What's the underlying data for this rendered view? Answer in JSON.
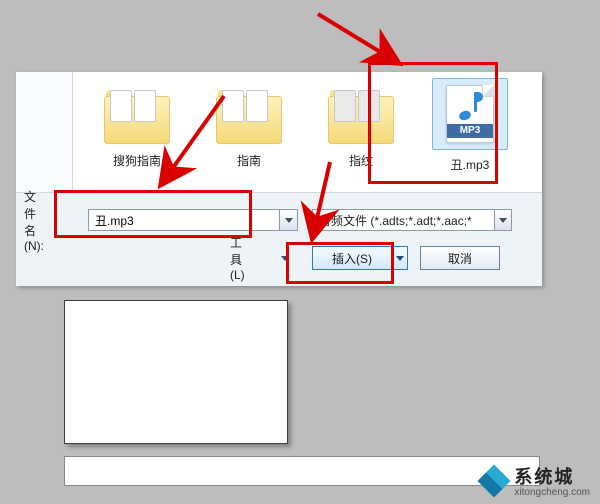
{
  "items": [
    {
      "label": "搜狗指南"
    },
    {
      "label": "指南"
    },
    {
      "label": "指纹"
    }
  ],
  "mp3": {
    "label": "丑.mp3",
    "badge": "MP3"
  },
  "form": {
    "filename_label": "文件名(N):",
    "filename_value": "丑.mp3",
    "filter_label": "音频文件 (*.adts;*.adt;*.aac;*",
    "tools_label": "工具(L)",
    "insert_label": "插入(S)",
    "cancel_label": "取消"
  },
  "watermark": {
    "title": "系统城",
    "url": "xitongcheng.com"
  }
}
